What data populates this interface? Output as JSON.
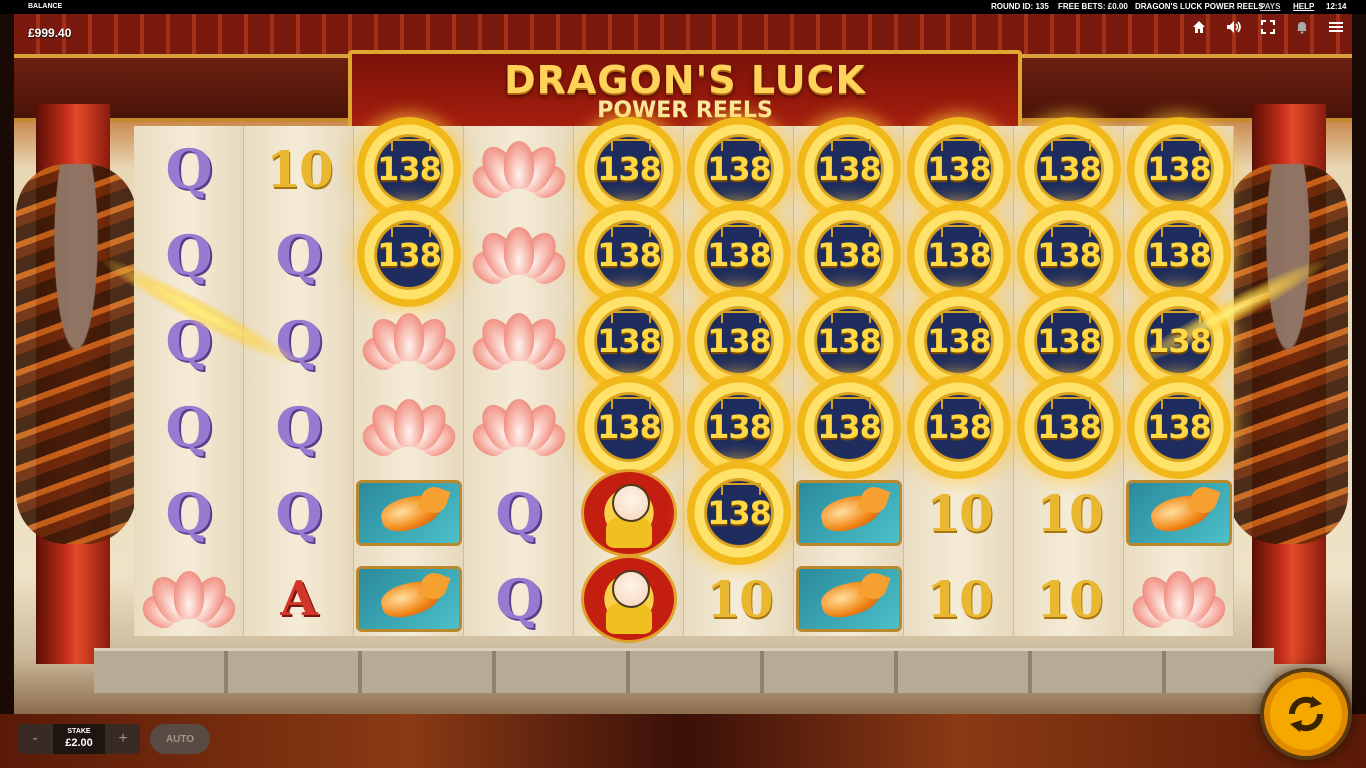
{
  "top_bar": {
    "balance_label": "BALANCE",
    "balance_value": "£999.40",
    "round_id": "ROUND ID: 135",
    "free_bets": "FREE BETS: £0.00",
    "game_name": "DRAGON'S LUCK POWER REELS",
    "pays_link": "PAYS",
    "help_link": "HELP",
    "clock": "12:14",
    "icons": [
      "home-icon",
      "sound-icon",
      "fullscreen-icon",
      "notification-icon",
      "menu-icon"
    ]
  },
  "title": {
    "line1": "DRAGON'S LUCK",
    "line2": "POWER REELS"
  },
  "reels": {
    "coin_value": "138",
    "grid": [
      [
        "Q",
        "Q",
        "Q",
        "Q",
        "Q",
        "lotus"
      ],
      [
        "10",
        "Q",
        "Q",
        "Q",
        "Q",
        "A"
      ],
      [
        "coin",
        "coin",
        "lotus",
        "lotus",
        "koi",
        "koi"
      ],
      [
        "lotus",
        "lotus",
        "lotus",
        "lotus",
        "Q",
        "Q"
      ],
      [
        "coin",
        "coin",
        "coin",
        "coin",
        "doll",
        "doll"
      ],
      [
        "coin",
        "coin",
        "coin",
        "coin",
        "coin",
        "10"
      ],
      [
        "coin",
        "coin",
        "coin",
        "coin",
        "koi",
        "koi"
      ],
      [
        "coin",
        "coin",
        "coin",
        "coin",
        "10",
        "10"
      ],
      [
        "coin",
        "coin",
        "coin",
        "coin",
        "10",
        "10"
      ],
      [
        "coin",
        "coin",
        "coin",
        "coin",
        "koi",
        "lotus"
      ]
    ]
  },
  "controls": {
    "minus": "-",
    "plus": "+",
    "stake_label": "STAKE",
    "stake_value": "£2.00",
    "auto_label": "AUTO"
  }
}
